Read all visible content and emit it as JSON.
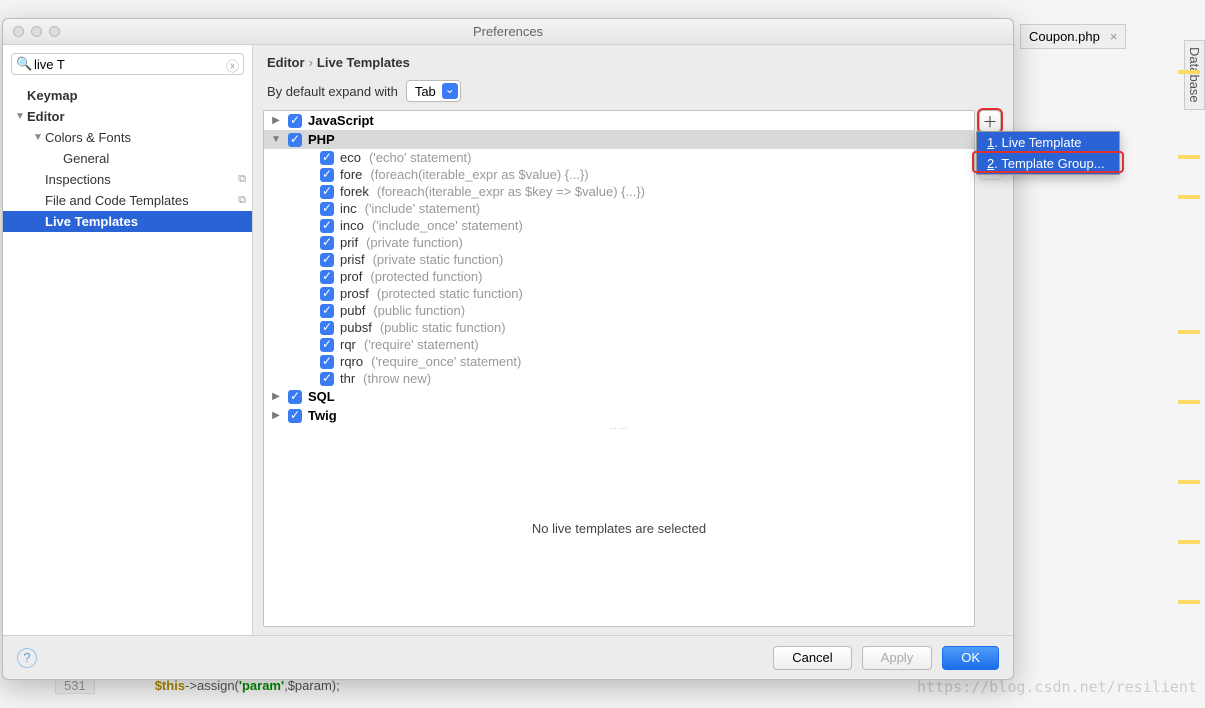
{
  "bg": {
    "tab_label": "Coupon.php",
    "database_label": "Database",
    "code_line": "531",
    "code_prefix": "$this->assign(",
    "code_str": "'param'",
    "code_suffix": ",$param);",
    "watermark": "https://blog.csdn.net/resilient"
  },
  "dialog": {
    "title": "Preferences",
    "search_value": "live T",
    "tree": {
      "keymap": "Keymap",
      "editor": "Editor",
      "colors_fonts": "Colors & Fonts",
      "general": "General",
      "inspections": "Inspections",
      "file_code_templates": "File and Code Templates",
      "live_templates": "Live Templates"
    },
    "crumb_editor": "Editor",
    "crumb_page": "Live Templates",
    "expand_label": "By default expand with",
    "expand_value": "Tab",
    "groups": [
      {
        "name": "JavaScript",
        "expanded": false
      },
      {
        "name": "PHP",
        "expanded": true,
        "templates": [
          {
            "abbr": "eco",
            "desc": "('echo' statement)"
          },
          {
            "abbr": "fore",
            "desc": "(foreach(iterable_expr as $value) {...})"
          },
          {
            "abbr": "forek",
            "desc": "(foreach(iterable_expr as $key => $value) {...})"
          },
          {
            "abbr": "inc",
            "desc": "('include' statement)"
          },
          {
            "abbr": "inco",
            "desc": "('include_once' statement)"
          },
          {
            "abbr": "prif",
            "desc": "(private function)"
          },
          {
            "abbr": "prisf",
            "desc": "(private static function)"
          },
          {
            "abbr": "prof",
            "desc": "(protected function)"
          },
          {
            "abbr": "prosf",
            "desc": "(protected static function)"
          },
          {
            "abbr": "pubf",
            "desc": "(public function)"
          },
          {
            "abbr": "pubsf",
            "desc": "(public static function)"
          },
          {
            "abbr": "rqr",
            "desc": "('require' statement)"
          },
          {
            "abbr": "rqro",
            "desc": "('require_once' statement)"
          },
          {
            "abbr": "thr",
            "desc": "(throw new)"
          }
        ]
      },
      {
        "name": "SQL",
        "expanded": false
      },
      {
        "name": "Twig",
        "expanded": false
      }
    ],
    "empty_message": "No live templates are selected",
    "popup": {
      "item1_num": "1",
      "item1_label": ". Live Template",
      "item2_num": "2",
      "item2_label": ". Template Group..."
    },
    "buttons": {
      "cancel": "Cancel",
      "apply": "Apply",
      "ok": "OK"
    }
  }
}
